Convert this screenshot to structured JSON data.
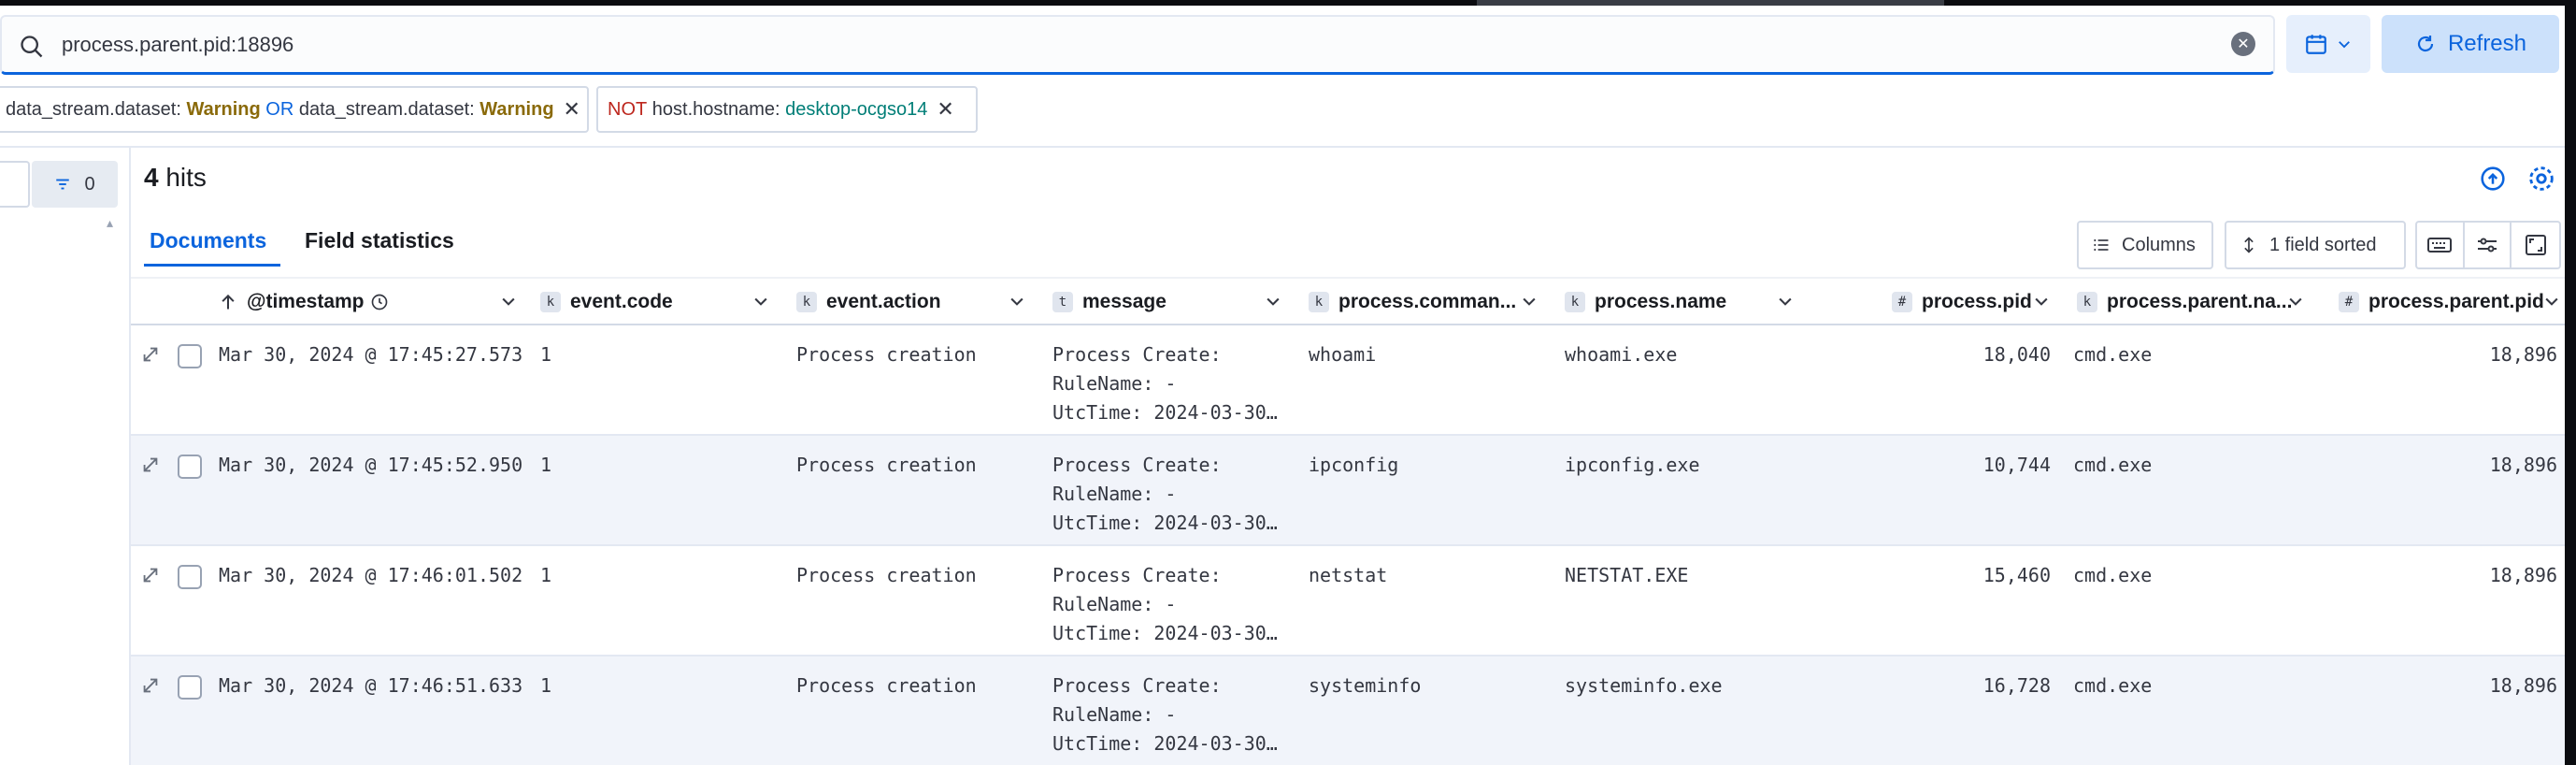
{
  "search": {
    "query": "process.parent.pid:18896",
    "refresh_label": "Refresh"
  },
  "filters": [
    {
      "field1": "data_stream.dataset:",
      "value1": "Warning",
      "op": "OR",
      "field2": "data_stream.dataset:",
      "value2": "Warning"
    },
    {
      "neg": "NOT",
      "field": "host.hostname:",
      "value": "desktop-ocgso14"
    }
  ],
  "sidebar": {
    "filter_count": "0"
  },
  "results": {
    "hits_count": "4",
    "hits_label": "hits"
  },
  "tabs": [
    {
      "label": "Documents",
      "active": true
    },
    {
      "label": "Field statistics",
      "active": false
    }
  ],
  "toolbar": {
    "columns_label": "Columns",
    "sort_label": "1 field sorted"
  },
  "columns": [
    {
      "type": "",
      "label": "@timestamp"
    },
    {
      "type": "k",
      "label": "event.code"
    },
    {
      "type": "k",
      "label": "event.action"
    },
    {
      "type": "t",
      "label": "message"
    },
    {
      "type": "k",
      "label": "process.comman..."
    },
    {
      "type": "k",
      "label": "process.name"
    },
    {
      "type": "#",
      "label": "process.pid"
    },
    {
      "type": "k",
      "label": "process.parent.na..."
    },
    {
      "type": "#",
      "label": "process.parent.pid"
    }
  ],
  "rows": [
    {
      "timestamp": "Mar 30, 2024 @ 17:45:27.573",
      "event_code": "1",
      "event_action": "Process creation",
      "msg1": "Process Create:",
      "msg2": "RuleName: -",
      "msg3": "UtcTime: 2024-03-30…",
      "command": "whoami",
      "name": "whoami.exe",
      "pid": "18,040",
      "parent_name": "cmd.exe",
      "parent_pid": "18,896"
    },
    {
      "timestamp": "Mar 30, 2024 @ 17:45:52.950",
      "event_code": "1",
      "event_action": "Process creation",
      "msg1": "Process Create:",
      "msg2": "RuleName: -",
      "msg3": "UtcTime: 2024-03-30…",
      "command": "ipconfig",
      "name": "ipconfig.exe",
      "pid": "10,744",
      "parent_name": "cmd.exe",
      "parent_pid": "18,896"
    },
    {
      "timestamp": "Mar 30, 2024 @ 17:46:01.502",
      "event_code": "1",
      "event_action": "Process creation",
      "msg1": "Process Create:",
      "msg2": "RuleName: -",
      "msg3": "UtcTime: 2024-03-30…",
      "command": "netstat",
      "name": "NETSTAT.EXE",
      "pid": "15,460",
      "parent_name": "cmd.exe",
      "parent_pid": "18,896"
    },
    {
      "timestamp": "Mar 30, 2024 @ 17:46:51.633",
      "event_code": "1",
      "event_action": "Process creation",
      "msg1": "Process Create:",
      "msg2": "RuleName: -",
      "msg3": "UtcTime: 2024-03-30…",
      "command": "systeminfo",
      "name": "systeminfo.exe",
      "pid": "16,728",
      "parent_name": "cmd.exe",
      "parent_pid": "18,896"
    }
  ],
  "colors": {
    "accent": "#0b64dd",
    "warning_value": "#8a6a0a",
    "not": "#bd271e",
    "teal_value": "#007e77"
  }
}
